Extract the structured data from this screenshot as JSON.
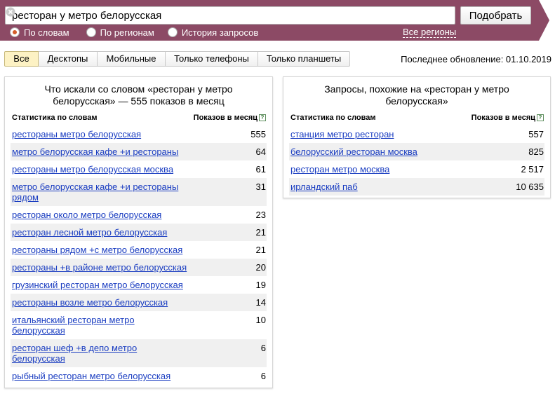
{
  "colors": {
    "header_band": "#8c4a65",
    "link": "#1a3dc1",
    "active_tab": "#fdf2c4",
    "row_shade": "#f0f0f0"
  },
  "search": {
    "value": "ресторан у метро белорусская",
    "submit_label": "Подобрать",
    "clear_icon": "clear-icon"
  },
  "modes": {
    "options": [
      "По словам",
      "По регионам",
      "История запросов"
    ],
    "selected": 0,
    "regions_link": "Все регионы"
  },
  "tabs": [
    "Все",
    "Десктопы",
    "Мобильные",
    "Только телефоны",
    "Только планшеты"
  ],
  "active_tab": 0,
  "last_update": "Последнее обновление: 01.10.2019",
  "left_panel": {
    "title": "Что искали со словом «ресторан у метро белорусская» — 555 показов в месяц",
    "col_query": "Статистика по словам",
    "col_count": "Показов в месяц",
    "help": "?",
    "rows": [
      {
        "q": "рестораны метро белорусская",
        "n": "555"
      },
      {
        "q": "метро белорусская кафе +и рестораны",
        "n": "64"
      },
      {
        "q": "рестораны метро белорусская москва",
        "n": "61"
      },
      {
        "q": "метро белорусская кафе +и рестораны рядом",
        "n": "31"
      },
      {
        "q": "ресторан около метро белорусская",
        "n": "23"
      },
      {
        "q": "ресторан лесной метро белорусская",
        "n": "21"
      },
      {
        "q": "рестораны рядом +с метро белорусская",
        "n": "21"
      },
      {
        "q": "рестораны +в районе метро белорусская",
        "n": "20"
      },
      {
        "q": "грузинский ресторан метро белорусская",
        "n": "19"
      },
      {
        "q": "рестораны возле метро белорусская",
        "n": "14"
      },
      {
        "q": "итальянский ресторан метро белорусская",
        "n": "10"
      },
      {
        "q": "ресторан шеф +в депо метро белорусская",
        "n": "6"
      },
      {
        "q": "рыбный ресторан метро белорусская",
        "n": "6"
      }
    ]
  },
  "right_panel": {
    "title": "Запросы, похожие на «ресторан у метро белорусская»",
    "col_query": "Статистика по словам",
    "col_count": "Показов в месяц",
    "help": "?",
    "rows": [
      {
        "q": "станция метро ресторан",
        "n": "557"
      },
      {
        "q": "белорусский ресторан москва",
        "n": "825"
      },
      {
        "q": "ресторан метро москва",
        "n": "2 517"
      },
      {
        "q": "ирландский паб",
        "n": "10 635"
      }
    ]
  }
}
